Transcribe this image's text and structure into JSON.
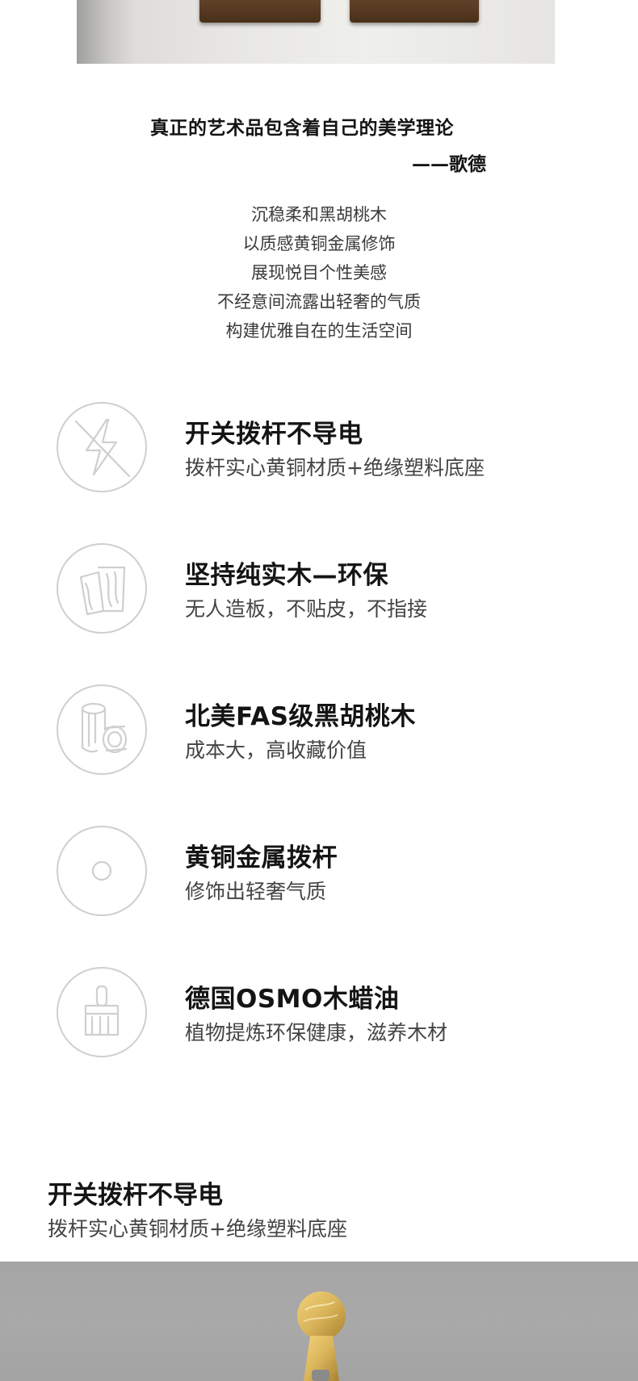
{
  "quote": {
    "text": "真正的艺术品包含着自己的美学理论",
    "author": "——歌德"
  },
  "poem": [
    "沉稳柔和黑胡桃木",
    "以质感黄铜金属修饰",
    "展现悦目个性美感",
    "不经意间流露出轻奢的气质",
    "构建优雅自在的生活空间"
  ],
  "features": [
    {
      "icon": "no-electricity-icon",
      "title": "开关拨杆不导电",
      "desc": "拨杆实心黄铜材质+绝缘塑料底座"
    },
    {
      "icon": "wood-board-icon",
      "title": "坚持纯实木—环保",
      "desc": "无人造板，不贴皮，不指接"
    },
    {
      "icon": "wood-logs-icon",
      "title": "北美FAS级黑胡桃木",
      "desc": "成本大，高收藏价值"
    },
    {
      "icon": "brass-disc-icon",
      "title": "黄铜金属拨杆",
      "desc": "修饰出轻奢气质"
    },
    {
      "icon": "paint-brush-icon",
      "title": "德国OSMO木蜡油",
      "desc": "植物提炼环保健康，滋养木材"
    }
  ],
  "section": {
    "title": "开关拨杆不导电",
    "desc": "拨杆实心黄铜材质+绝缘塑料底座"
  },
  "colors": {
    "text": "#141414",
    "secondary": "#444444",
    "icon_stroke": "#cfcfcf",
    "brass": "#d9b45a",
    "walnut": "#5a3c24"
  }
}
